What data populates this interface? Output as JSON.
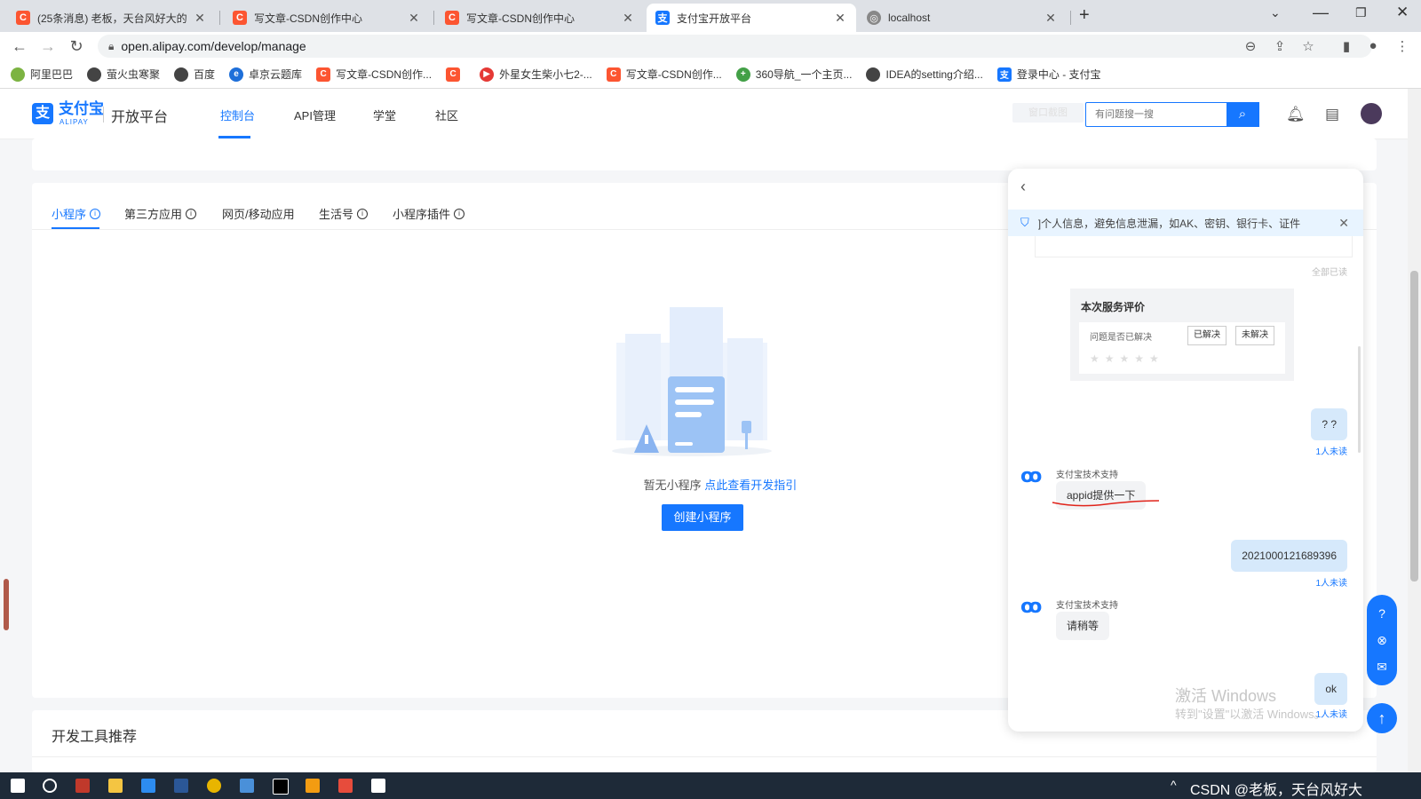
{
  "browser": {
    "tabs": [
      {
        "title": "(25条消息) 老板，天台风好大的",
        "icon": "csdn-icon",
        "active": false
      },
      {
        "title": "写文章-CSDN创作中心",
        "icon": "csdn-icon",
        "active": false
      },
      {
        "title": "写文章-CSDN创作中心",
        "icon": "csdn-icon",
        "active": false
      },
      {
        "title": "支付宝开放平台",
        "icon": "alipay-icon",
        "active": true
      },
      {
        "title": "localhost",
        "icon": "globe-icon",
        "active": false
      }
    ],
    "url": "open.alipay.com/develop/manage",
    "bookmarks": [
      {
        "label": "阿里巴巴",
        "color": "#7cb342"
      },
      {
        "label": "萤火虫寒聚",
        "color": "#333333"
      },
      {
        "label": "百度",
        "color": "#333333"
      },
      {
        "label": "卓京云题库",
        "color": "#1e6fd9"
      },
      {
        "label": "写文章-CSDN创作...",
        "color": "#fc5531"
      },
      {
        "label": "",
        "color": "#fc5531"
      },
      {
        "label": "外星女生柴小七2-...",
        "color": "#e53935"
      },
      {
        "label": "写文章-CSDN创作...",
        "color": "#fc5531"
      },
      {
        "label": "360导航_一个主页...",
        "color": "#43a047"
      },
      {
        "label": "IDEA的setting介绍...",
        "color": "#333333"
      },
      {
        "label": "登录中心 - 支付宝",
        "color": "#1677ff"
      }
    ]
  },
  "header": {
    "logo_text": "支付宝",
    "logo_sub": "ALIPAY",
    "platform": "开放平台",
    "nav": [
      "控制台",
      "API管理",
      "学堂",
      "社区"
    ],
    "search_placeholder": "有问题搜一搜",
    "faint_label": "窗口截图"
  },
  "subtabs": [
    "小程序",
    "第三方应用",
    "网页/移动应用",
    "生活号",
    "小程序插件"
  ],
  "empty": {
    "text": "暂无小程序 ",
    "link": "点此查看开发指引",
    "button": "创建小程序"
  },
  "section2_title": "开发工具推荐",
  "chat": {
    "notice": "]个人信息，避免信息泄漏，如AK、密钥、银行卡、证件",
    "read_all": "全部已读",
    "eval_title": "本次服务评价",
    "eval_question": "问题是否已解决",
    "eval_yes": "已解决",
    "eval_no": "未解决",
    "messages": [
      {
        "side": "right",
        "text": "? ?",
        "status": "1人未读"
      },
      {
        "side": "left",
        "sender": "支付宝技术支持",
        "text": "appid提供一下"
      },
      {
        "side": "right",
        "text": "2021000121689396",
        "status": "1人未读"
      },
      {
        "side": "left",
        "sender": "支付宝技术支持",
        "text": "请稍等"
      },
      {
        "side": "right",
        "text": "ok",
        "status": "1人未读"
      }
    ],
    "watermark_1": "激活 Windows",
    "watermark_2": "转到\"设置\"以激活 Windows。"
  },
  "taskbar": {
    "watermark": "CSDN @老板，天台风好大"
  },
  "colors": {
    "brand": "#1677ff",
    "chat_bubble_self": "#d6e9fb",
    "taskbar": "#1e2a38"
  }
}
